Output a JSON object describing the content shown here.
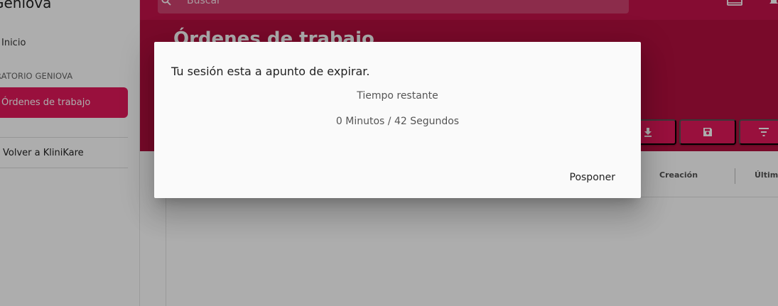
{
  "sidebar": {
    "brand": "Geniova",
    "items": [
      {
        "label": "Inicio"
      },
      {
        "label": "Órdenes de trabajo"
      },
      {
        "label": "Volver a KliniKare"
      }
    ],
    "section_title": "RATORIO GENIOVA"
  },
  "topbar": {
    "search_placeholder": "Buscar"
  },
  "main": {
    "title": "Órdenes de trabajo",
    "toolbar": [
      "download-icon",
      "save-icon",
      "filter-icon"
    ],
    "table": {
      "columns": [
        "Creación",
        "Últimc"
      ]
    }
  },
  "dialog": {
    "message": "Tu sesión esta a apunto de expirar.",
    "label": "Tiempo restante",
    "time": "0 Minutos / 42 Segundos",
    "action": "Posponer"
  },
  "colors": {
    "accent": "#e2185b",
    "header": "#b3103f",
    "topbar": "#c4124b"
  }
}
